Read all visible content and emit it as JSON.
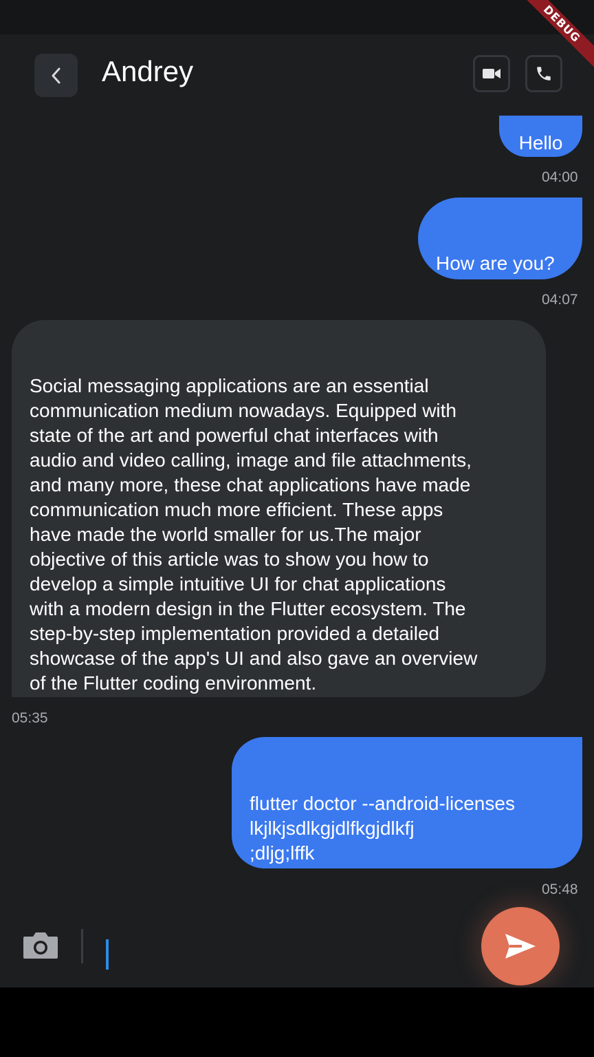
{
  "debug_banner": "DEBUG",
  "header": {
    "contact_name": "Andrey",
    "icons": {
      "back": "chevron-left-icon",
      "video": "video-camera-icon",
      "call": "phone-icon"
    }
  },
  "messages": [
    {
      "direction": "sent",
      "text": "Hello",
      "time": "04:00"
    },
    {
      "direction": "sent",
      "text": "How are you?",
      "time": "04:07"
    },
    {
      "direction": "received",
      "text": "Social messaging applications are an essential\ncommunication medium nowadays. Equipped with\nstate of the art and powerful chat interfaces with\naudio and video calling, image and file attachments,\nand many more, these chat applications have made\ncommunication much more efficient. These apps\nhave made the world smaller for us.The major\nobjective of this article was to show you how to\ndevelop a simple intuitive UI for chat applications\nwith a modern design in the Flutter ecosystem. The\nstep-by-step implementation provided a detailed\nshowcase of the app's UI and also gave an overview\nof the Flutter coding environment.",
      "time": "05:35"
    },
    {
      "direction": "sent",
      "text": "flutter doctor --android-licenses\nlkjlkjsdlkgjdlfkgjdlkfj\n;dljg;lffk",
      "time": "05:48"
    }
  ],
  "input_bar": {
    "value": "",
    "icons": {
      "camera": "camera-icon",
      "send": "send-icon"
    }
  },
  "colors": {
    "background": "#1c1e20",
    "sent_bubble": "#3b79ef",
    "received_bubble": "#2e3134",
    "send_button": "#df7257",
    "caret": "#2b8de5"
  }
}
